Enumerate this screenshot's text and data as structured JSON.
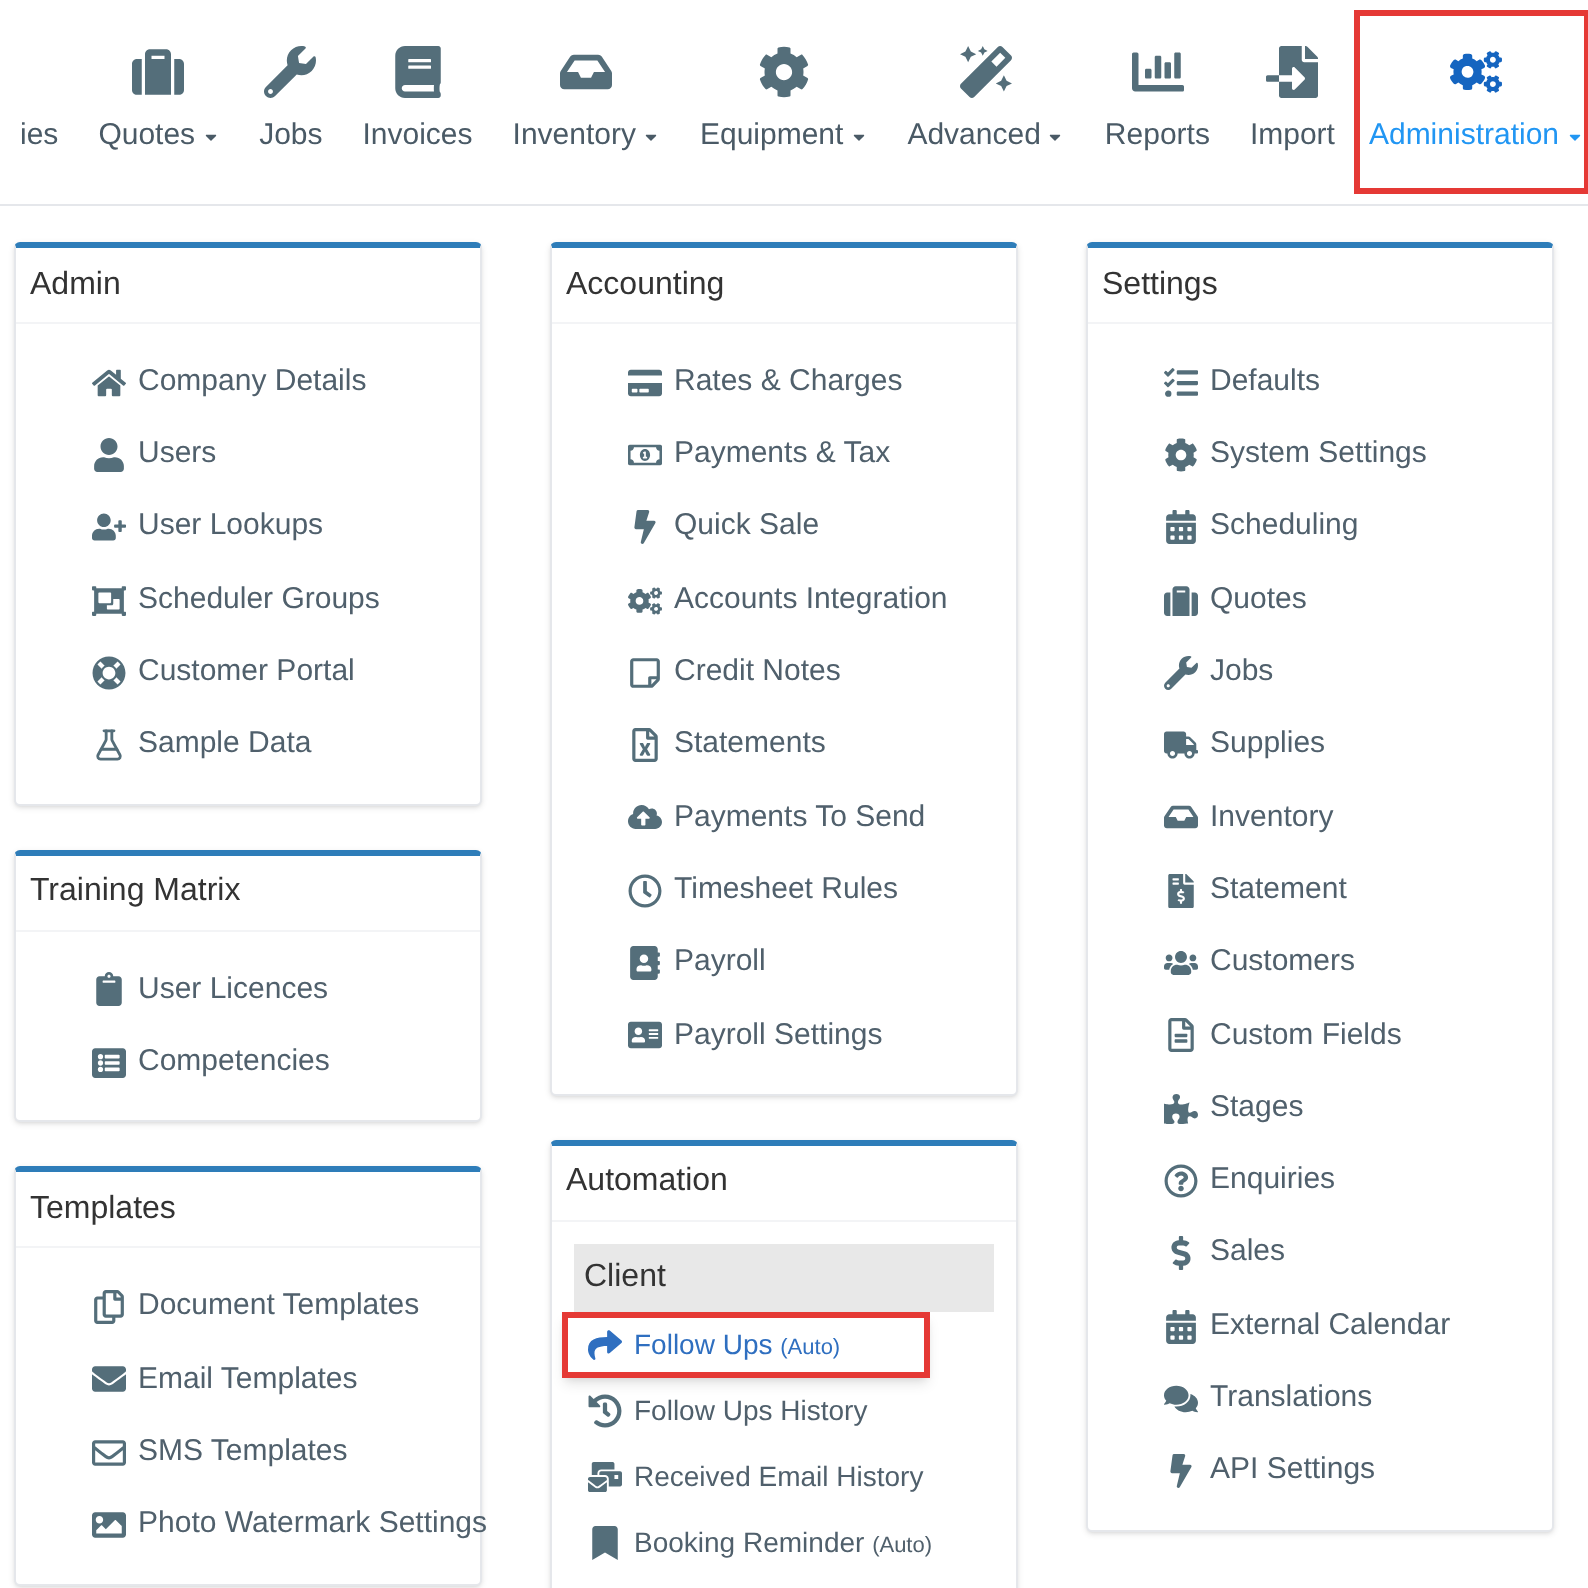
{
  "nav": {
    "items": [
      {
        "label": "ies",
        "dropdown": false,
        "selected": false,
        "highlighted": false
      },
      {
        "label": "Quotes",
        "dropdown": true,
        "selected": false,
        "highlighted": false
      },
      {
        "label": "Jobs",
        "dropdown": false,
        "selected": false,
        "highlighted": false
      },
      {
        "label": "Invoices",
        "dropdown": false,
        "selected": false,
        "highlighted": false
      },
      {
        "label": "Inventory",
        "dropdown": true,
        "selected": false,
        "highlighted": false
      },
      {
        "label": "Equipment",
        "dropdown": true,
        "selected": false,
        "highlighted": false
      },
      {
        "label": "Advanced",
        "dropdown": true,
        "selected": false,
        "highlighted": false
      },
      {
        "label": "Reports",
        "dropdown": false,
        "selected": false,
        "highlighted": false
      },
      {
        "label": "Import",
        "dropdown": false,
        "selected": false,
        "highlighted": false
      },
      {
        "label": "Administration",
        "dropdown": true,
        "selected": true,
        "highlighted": true
      }
    ]
  },
  "columns": [
    [
      {
        "kind": "list",
        "title": "Admin",
        "items": [
          {
            "label": "Company Details"
          },
          {
            "label": "Users"
          },
          {
            "label": "User Lookups"
          },
          {
            "label": "Scheduler Groups"
          },
          {
            "label": "Customer Portal"
          },
          {
            "label": "Sample Data"
          }
        ]
      },
      {
        "kind": "list",
        "title": "Training Matrix",
        "items": [
          {
            "label": "User Licences"
          },
          {
            "label": "Competencies"
          }
        ]
      },
      {
        "kind": "list",
        "title": "Templates",
        "items": [
          {
            "label": "Document Templates"
          },
          {
            "label": "Email Templates"
          },
          {
            "label": "SMS Templates"
          },
          {
            "label": "Photo Watermark Settings"
          }
        ]
      }
    ],
    [
      {
        "kind": "list",
        "title": "Accounting",
        "items": [
          {
            "label": "Rates & Charges"
          },
          {
            "label": "Payments & Tax"
          },
          {
            "label": "Quick Sale"
          },
          {
            "label": "Accounts Integration"
          },
          {
            "label": "Credit Notes"
          },
          {
            "label": "Statements"
          },
          {
            "label": "Payments To Send"
          },
          {
            "label": "Timesheet Rules"
          },
          {
            "label": "Payroll"
          },
          {
            "label": "Payroll Settings"
          }
        ]
      },
      {
        "kind": "grouped",
        "title": "Automation",
        "groups": [
          {
            "title": "Client",
            "items": [
              {
                "label": "Follow Ups",
                "suffix": "(Auto)",
                "selected": true,
                "highlighted": true
              },
              {
                "label": "Follow Ups History",
                "selected": false,
                "highlighted": false
              },
              {
                "label": "Received Email History",
                "selected": false,
                "highlighted": false
              },
              {
                "label": "Booking Reminder",
                "suffix": "(Auto)",
                "selected": false,
                "highlighted": false
              }
            ]
          }
        ]
      }
    ],
    [
      {
        "kind": "list",
        "title": "Settings",
        "items": [
          {
            "label": "Defaults"
          },
          {
            "label": "System Settings"
          },
          {
            "label": "Scheduling"
          },
          {
            "label": "Quotes"
          },
          {
            "label": "Jobs"
          },
          {
            "label": "Supplies"
          },
          {
            "label": "Inventory"
          },
          {
            "label": "Statement"
          },
          {
            "label": "Customers"
          },
          {
            "label": "Custom Fields"
          },
          {
            "label": "Stages"
          },
          {
            "label": "Enquiries"
          },
          {
            "label": "Sales"
          },
          {
            "label": "External Calendar"
          },
          {
            "label": "Translations"
          },
          {
            "label": "API Settings"
          }
        ]
      }
    ]
  ]
}
